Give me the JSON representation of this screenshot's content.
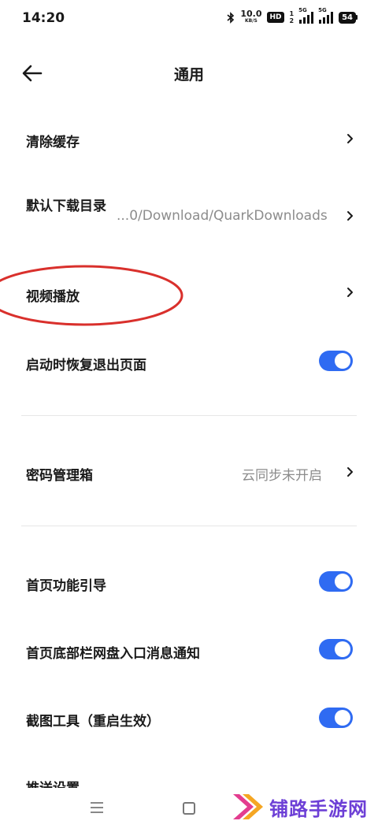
{
  "status_bar": {
    "time": "14:20",
    "net_speed_value": "10.0",
    "net_speed_unit": "KB/S",
    "hd_badge": "HD",
    "hd_sub_top": "1",
    "hd_sub_bottom": "2",
    "sim1_label": "5G",
    "sim2_label": "5G",
    "battery": "54"
  },
  "header": {
    "back_icon": "arrow-left-icon",
    "title": "通用"
  },
  "settings": {
    "clear_cache": {
      "label": "清除缓存"
    },
    "download_dir": {
      "label": "默认下载目录",
      "value": "...0/Download/QuarkDownloads"
    },
    "video_playback": {
      "label": "视频播放"
    },
    "restore_on_launch": {
      "label": "启动时恢复退出页面",
      "enabled": true
    },
    "password_manager": {
      "label": "密码管理箱",
      "value": "云同步未开启"
    },
    "home_guide": {
      "label": "首页功能引导",
      "enabled": true
    },
    "home_netdisk_notice": {
      "label": "首页底部栏网盘入口消息通知",
      "enabled": true
    },
    "screenshot_tool": {
      "label": "截图工具（重启生效）",
      "enabled": true
    },
    "push_settings": {
      "label": "推送设置"
    }
  },
  "colors": {
    "accent": "#2f6bf2",
    "annotation": "#d9302c",
    "value_text": "#8c8c8c",
    "watermark": "#6d3fd6"
  },
  "watermark": {
    "text": "铺路手游网"
  }
}
